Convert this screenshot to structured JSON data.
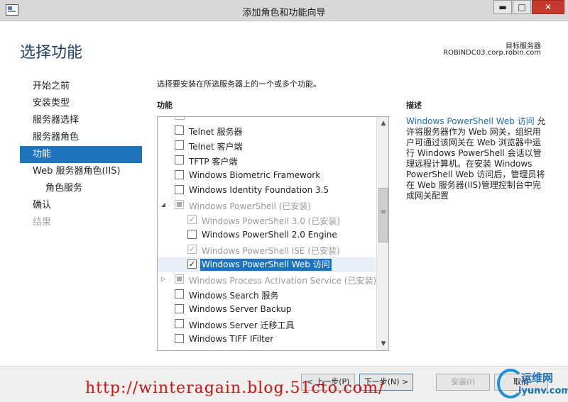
{
  "window": {
    "title": "添加角色和功能向导",
    "minimize_glyph": "▬",
    "maximize_glyph": "□",
    "close_glyph": "✕"
  },
  "header": {
    "title": "选择功能",
    "target_label": "目标服务器",
    "target_server": "ROBINDC03.corp.robin.com"
  },
  "nav": {
    "items": [
      {
        "label": "开始之前",
        "state": "normal"
      },
      {
        "label": "安装类型",
        "state": "normal"
      },
      {
        "label": "服务器选择",
        "state": "normal"
      },
      {
        "label": "服务器角色",
        "state": "normal"
      },
      {
        "label": "功能",
        "state": "active"
      },
      {
        "label": "Web 服务器角色(IIS)",
        "state": "normal"
      },
      {
        "label": "角色服务",
        "state": "sub"
      },
      {
        "label": "确认",
        "state": "normal"
      },
      {
        "label": "结果",
        "state": "disabled"
      }
    ]
  },
  "content": {
    "instruction": "选择要安装在所选服务器上的一个或多个功能。",
    "list_heading": "功能",
    "description_heading": "描述"
  },
  "features": [
    {
      "label": "Telnet 服务器",
      "check": "unchecked",
      "indent": 0,
      "expander": ""
    },
    {
      "label": "Telnet 客户端",
      "check": "unchecked",
      "indent": 0,
      "expander": ""
    },
    {
      "label": "TFTP 客户端",
      "check": "unchecked",
      "indent": 0,
      "expander": ""
    },
    {
      "label": "Windows Biometric Framework",
      "check": "unchecked",
      "indent": 0,
      "expander": ""
    },
    {
      "label": "Windows Identity Foundation 3.5",
      "check": "unchecked",
      "indent": 0,
      "expander": ""
    },
    {
      "label": "Windows PowerShell (已安装)",
      "check": "partial",
      "indent": 0,
      "expander": "expanded",
      "gray": true
    },
    {
      "label": "Windows PowerShell 3.0 (已安装)",
      "check": "checked",
      "indent": 1,
      "expander": "",
      "gray": true
    },
    {
      "label": "Windows PowerShell 2.0 Engine",
      "check": "unchecked",
      "indent": 1,
      "expander": ""
    },
    {
      "label": "Windows PowerShell ISE (已安装)",
      "check": "checked",
      "indent": 1,
      "expander": "",
      "gray": true
    },
    {
      "label": "Windows PowerShell Web 访问",
      "check": "checked",
      "indent": 1,
      "expander": "",
      "selected": true
    },
    {
      "label": "Windows Process Activation Service (已安装)",
      "check": "partial",
      "indent": 0,
      "expander": "collapsed",
      "gray": true
    },
    {
      "label": "Windows Search 服务",
      "check": "unchecked",
      "indent": 0,
      "expander": ""
    },
    {
      "label": "Windows Server Backup",
      "check": "unchecked",
      "indent": 0,
      "expander": ""
    },
    {
      "label": "Windows Server 迁移工具",
      "check": "unchecked",
      "indent": 0,
      "expander": ""
    },
    {
      "label": "Windows TIFF IFilter",
      "check": "unchecked",
      "indent": 0,
      "expander": ""
    }
  ],
  "glyphs": {
    "check": "✓",
    "expanded": "◢",
    "collapsed": "▷",
    "scroll_up": "▲",
    "scroll_down": "▼"
  },
  "description": {
    "link": "Windows PowerShell Web 访问",
    "text": " 允许将服务器作为 Web 网关，组织用户可通过该网关在 Web 浏览器中运行 Windows PowerShell 会话以管理远程计算机。在安装 Windows PowerShell Web 访问后，管理员将在 Web 服务器(IIS)管理控制台中完成网关配置"
  },
  "footer": {
    "prev": "< 上一步(P)",
    "next": "下一步(N) >",
    "install": "安装(I)",
    "cancel": "取消"
  },
  "watermark": {
    "url": "http://winteragain.blog.51cto.com/",
    "logo_top": "运维网",
    "logo_bottom": "iyunv.com"
  }
}
